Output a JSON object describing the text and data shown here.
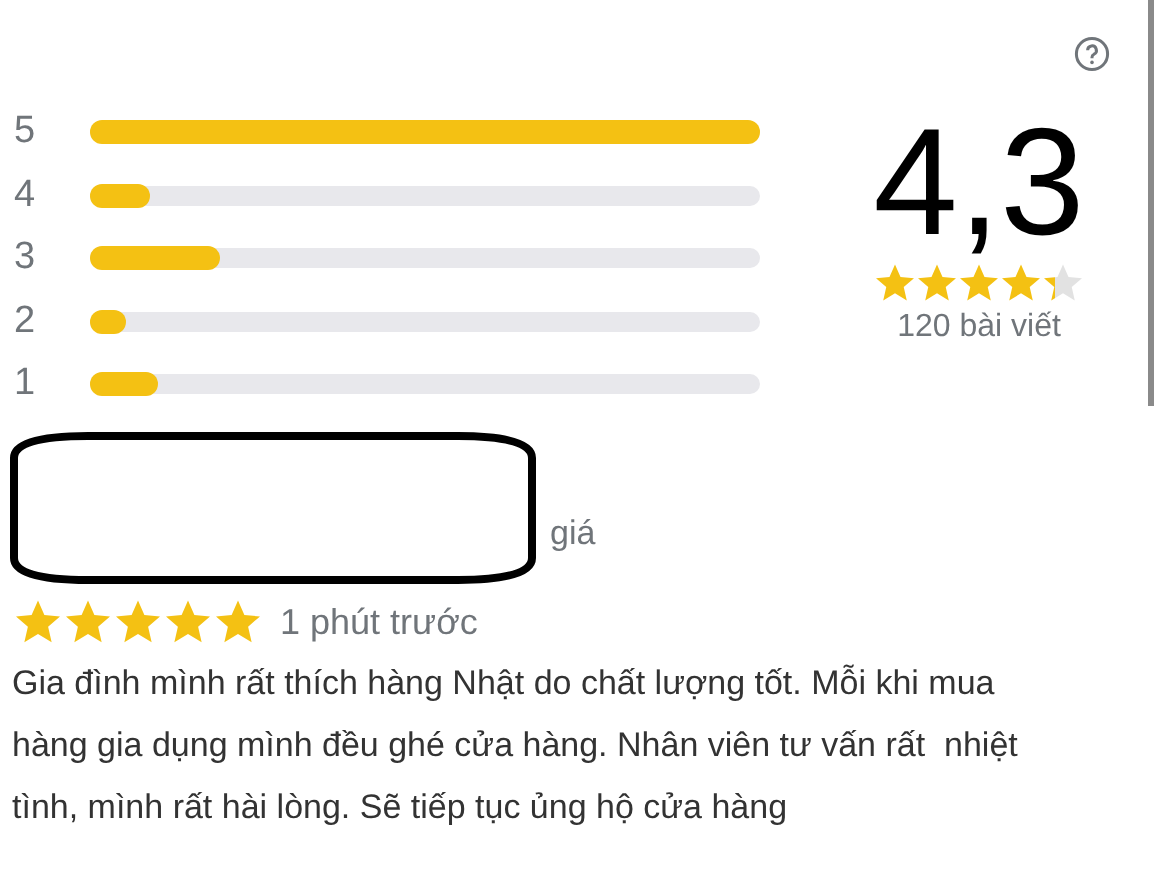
{
  "distribution": [
    {
      "label": "5",
      "level": 1.0
    },
    {
      "label": "4",
      "level": 0.09
    },
    {
      "label": "3",
      "level": 0.195
    },
    {
      "label": "2",
      "level": 0.055
    },
    {
      "label": "1",
      "level": 0.1
    }
  ],
  "summary": {
    "score": "4,3",
    "stars": 4.3,
    "count": "120 bài viết"
  },
  "review": {
    "author_tail": "giá",
    "stars": 5,
    "time": "1 phút trước",
    "text": "Gia đình mình rất thích hàng Nhật do chất lượng tốt. Mỗi khi mua hàng gia dụng mình đều ghé cửa hàng. Nhân viên tư vấn rất  nhiệt tình, mình rất hài lòng. Sẽ tiếp tục ủng hộ cửa hàng"
  }
}
